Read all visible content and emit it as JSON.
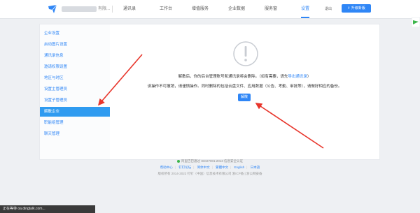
{
  "header": {
    "company_name": "有限...",
    "nav": [
      {
        "label": "通讯录"
      },
      {
        "label": "工作台"
      },
      {
        "label": "增值服务"
      },
      {
        "label": "企业数据"
      },
      {
        "label": "服务窗"
      },
      {
        "label": "设置"
      }
    ],
    "logout_label": "退出",
    "upgrade_label": "升级新版"
  },
  "sidebar": {
    "items": [
      {
        "label": "企业设置"
      },
      {
        "label": "启动图片设置"
      },
      {
        "label": "通讯录信息"
      },
      {
        "label": "邀请权限设置"
      },
      {
        "label": "地区与时区"
      },
      {
        "label": "设置主管理员"
      },
      {
        "label": "设置子管理员"
      },
      {
        "label": "解散企业"
      },
      {
        "label": "职能组管理"
      },
      {
        "label": "聊天管理"
      }
    ]
  },
  "main": {
    "line1_prefix": "解散后，你的后台管理账号和通讯录将会删除。（如有需要，请先",
    "line1_link": "导出通讯录",
    "line1_suffix": "）",
    "line2": "该操作不可撤销，请谨慎操作。同时删除的包括云盘文件、应用数据（公告、考勤、审批等），请做好相应的备份。",
    "unbind_label": "解散"
  },
  "footer": {
    "line1": "阿里巴巴通过 ISO27001:2013 信息安全认证",
    "links": [
      "帮助中心",
      "钉钉论坛",
      "简体中文",
      "繁體中文",
      "English",
      "日本語"
    ],
    "line3": "版权所有 2014-2022 钉钉（中国）信息技术有限公司 浙ICP备 | 浙公网安备"
  },
  "statusbar": {
    "text": "正在等待 oa.dingtalk.com..."
  },
  "colors": {
    "accent": "#2f86f6",
    "active_sidebar": "#2f9bf0",
    "arrow": "#e8352b"
  }
}
